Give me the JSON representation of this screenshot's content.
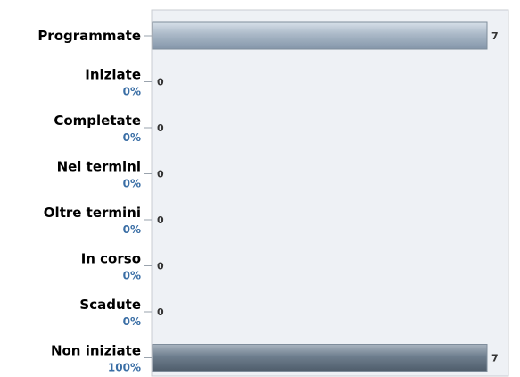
{
  "chart_data": {
    "type": "bar",
    "orientation": "horizontal",
    "categories": [
      "Programmate",
      "Iniziate",
      "Completate",
      "Nei termini",
      "Oltre termini",
      "In corso",
      "Scadute",
      "Non iniziate"
    ],
    "percent_labels": [
      "",
      "0%",
      "0%",
      "0%",
      "0%",
      "0%",
      "0%",
      "100%"
    ],
    "values": [
      7,
      0,
      0,
      0,
      0,
      0,
      0,
      7
    ],
    "xlim": [
      0,
      7
    ],
    "title": "",
    "xlabel": "",
    "ylabel": "",
    "grid": false,
    "legend": "none"
  },
  "colors": {
    "plot_background": "#eef1f5",
    "plot_border": "#c8ccd2",
    "percent_text": "#3a6ea5",
    "bar_light_top": "#d6dfe8",
    "bar_light_mid": "#aab8c7",
    "bar_light_bottom": "#8496aa",
    "bar_dark_top": "#a9b4bf",
    "bar_dark_mid": "#6e7e8e",
    "bar_dark_bottom": "#4f5d6b"
  }
}
